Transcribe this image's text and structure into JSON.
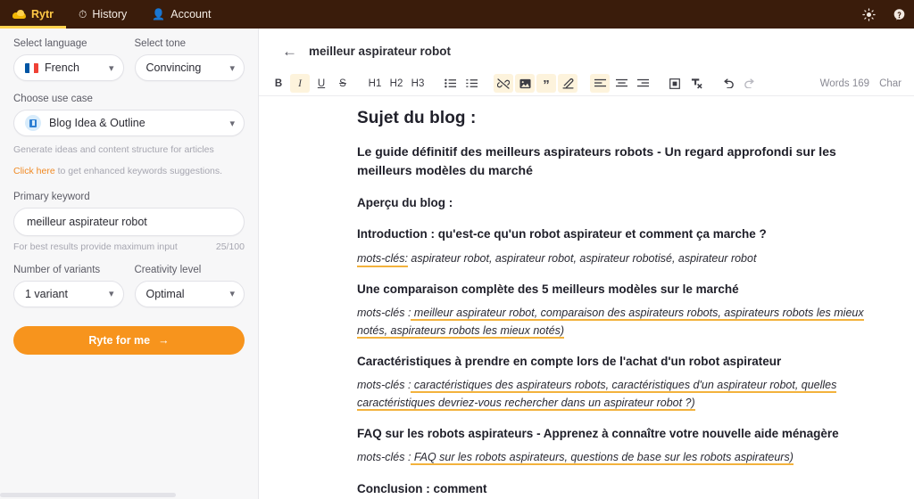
{
  "topbar": {
    "brand": "Rytr",
    "brand_icon": "rytr-cloud-logo",
    "items": [
      {
        "label": "Rytr",
        "icon": "rytr-cloud-logo",
        "active": true
      },
      {
        "label": "History",
        "icon": "history-clock-icon",
        "active": false
      },
      {
        "label": "Account",
        "icon": "account-person-icon",
        "active": false
      }
    ],
    "right_icons": [
      {
        "name": "brightness-sun-icon",
        "glyph": "☀"
      },
      {
        "name": "help-question-icon",
        "glyph": "?"
      }
    ],
    "background": "#3a1c0b",
    "accent": "#ffd24d"
  },
  "sidebar": {
    "language": {
      "label": "Select language",
      "value": "French",
      "flag": "fr-flag-icon"
    },
    "tone": {
      "label": "Select tone",
      "value": "Convincing"
    },
    "use_case": {
      "label": "Choose use case",
      "value": "Blog Idea & Outline",
      "icon": "blog-document-icon",
      "description": "Generate ideas and content structure for articles",
      "link_text": "Click here",
      "link_suffix": " to get enhanced keywords suggestions."
    },
    "primary_keyword": {
      "label": "Primary keyword",
      "value": "meilleur aspirateur robot",
      "placeholder": "Type your primary keyword",
      "helper": "For best results provide maximum input",
      "counter": "25/100"
    },
    "variants": {
      "label": "Number of variants",
      "value": "1 variant"
    },
    "creativity": {
      "label": "Creativity level",
      "value": "Optimal"
    },
    "cta": {
      "label": "Ryte for me",
      "arrow": "→",
      "color": "#f7941d"
    }
  },
  "document": {
    "back_icon": "back-arrow-icon",
    "title": "meilleur aspirateur robot",
    "toolbar": {
      "groups": [
        [
          {
            "name": "bold-button",
            "glyph": "B",
            "style": "bold",
            "active": false
          },
          {
            "name": "italic-button",
            "glyph": "I",
            "style": "italic",
            "active": true
          },
          {
            "name": "underline-button",
            "glyph": "U",
            "style": "underline",
            "active": false
          },
          {
            "name": "strikethrough-button",
            "glyph": "S",
            "style": "strike",
            "active": false
          }
        ],
        [
          {
            "name": "heading-1-button",
            "glyph": "H1",
            "active": false
          },
          {
            "name": "heading-2-button",
            "glyph": "H2",
            "active": false
          },
          {
            "name": "heading-3-button",
            "glyph": "H3",
            "active": false
          }
        ],
        [
          {
            "name": "bullet-list-button",
            "glyph": "☰",
            "active": false
          },
          {
            "name": "numbered-list-button",
            "glyph": "☲",
            "active": false
          }
        ],
        [
          {
            "name": "unlink-button",
            "glyph": "⊘",
            "active": true
          },
          {
            "name": "insert-image-button",
            "glyph": "▣",
            "active": true
          },
          {
            "name": "blockquote-button",
            "glyph": "”",
            "active": true
          },
          {
            "name": "highlight-pen-button",
            "glyph": "✐",
            "active": true
          }
        ],
        [
          {
            "name": "align-left-button",
            "glyph": "≡",
            "active": true
          },
          {
            "name": "align-center-button",
            "glyph": "≡",
            "active": false
          },
          {
            "name": "align-right-button",
            "glyph": "≡",
            "active": false
          }
        ],
        [
          {
            "name": "insert-table-button",
            "glyph": "▦",
            "active": false
          },
          {
            "name": "clear-formatting-button",
            "glyph": "✗",
            "active": false
          }
        ],
        [
          {
            "name": "undo-button",
            "glyph": "↶",
            "active": false,
            "dim": false
          },
          {
            "name": "redo-button",
            "glyph": "↷",
            "active": false,
            "dim": true
          }
        ]
      ],
      "words_label": "Words 169",
      "chars_label": "Char"
    },
    "content": {
      "title_line": "Sujet du blog :",
      "subject": "Le guide définitif des meilleurs aspirateurs robots - Un regard approfondi sur les meilleurs modèles du marché",
      "overview_label": "Aperçu du blog :",
      "sections": [
        {
          "heading": "Introduction : qu'est-ce qu'un robot aspirateur et comment ça marche ?",
          "keywords_label": "mots-clés:",
          "keywords": " aspirateur robot, aspirateur robot, aspirateur robotisé, aspirateur robot"
        },
        {
          "heading": "Une comparaison complète des 5 meilleurs modèles sur le marché",
          "keywords_label": "mots-clés :",
          "keywords": " meilleur aspirateur robot, comparaison des aspirateurs robots, aspirateurs robots les mieux notés, aspirateurs robots les mieux notés)"
        },
        {
          "heading": "Caractéristiques à prendre en compte lors de l'achat d'un robot aspirateur",
          "keywords_label": "mots-clés :",
          "keywords": " caractéristiques des aspirateurs robots, caractéristiques d'un aspirateur robot, quelles caractéristiques devriez-vous rechercher dans un aspirateur robot ?)"
        },
        {
          "heading": "FAQ sur les robots aspirateurs - Apprenez à connaître votre nouvelle aide ménagère",
          "keywords_label": "mots-clés :",
          "keywords": " FAQ sur les robots aspirateurs, questions de base sur les robots aspirateurs)"
        }
      ],
      "conclusion": "Conclusion : comment"
    }
  }
}
